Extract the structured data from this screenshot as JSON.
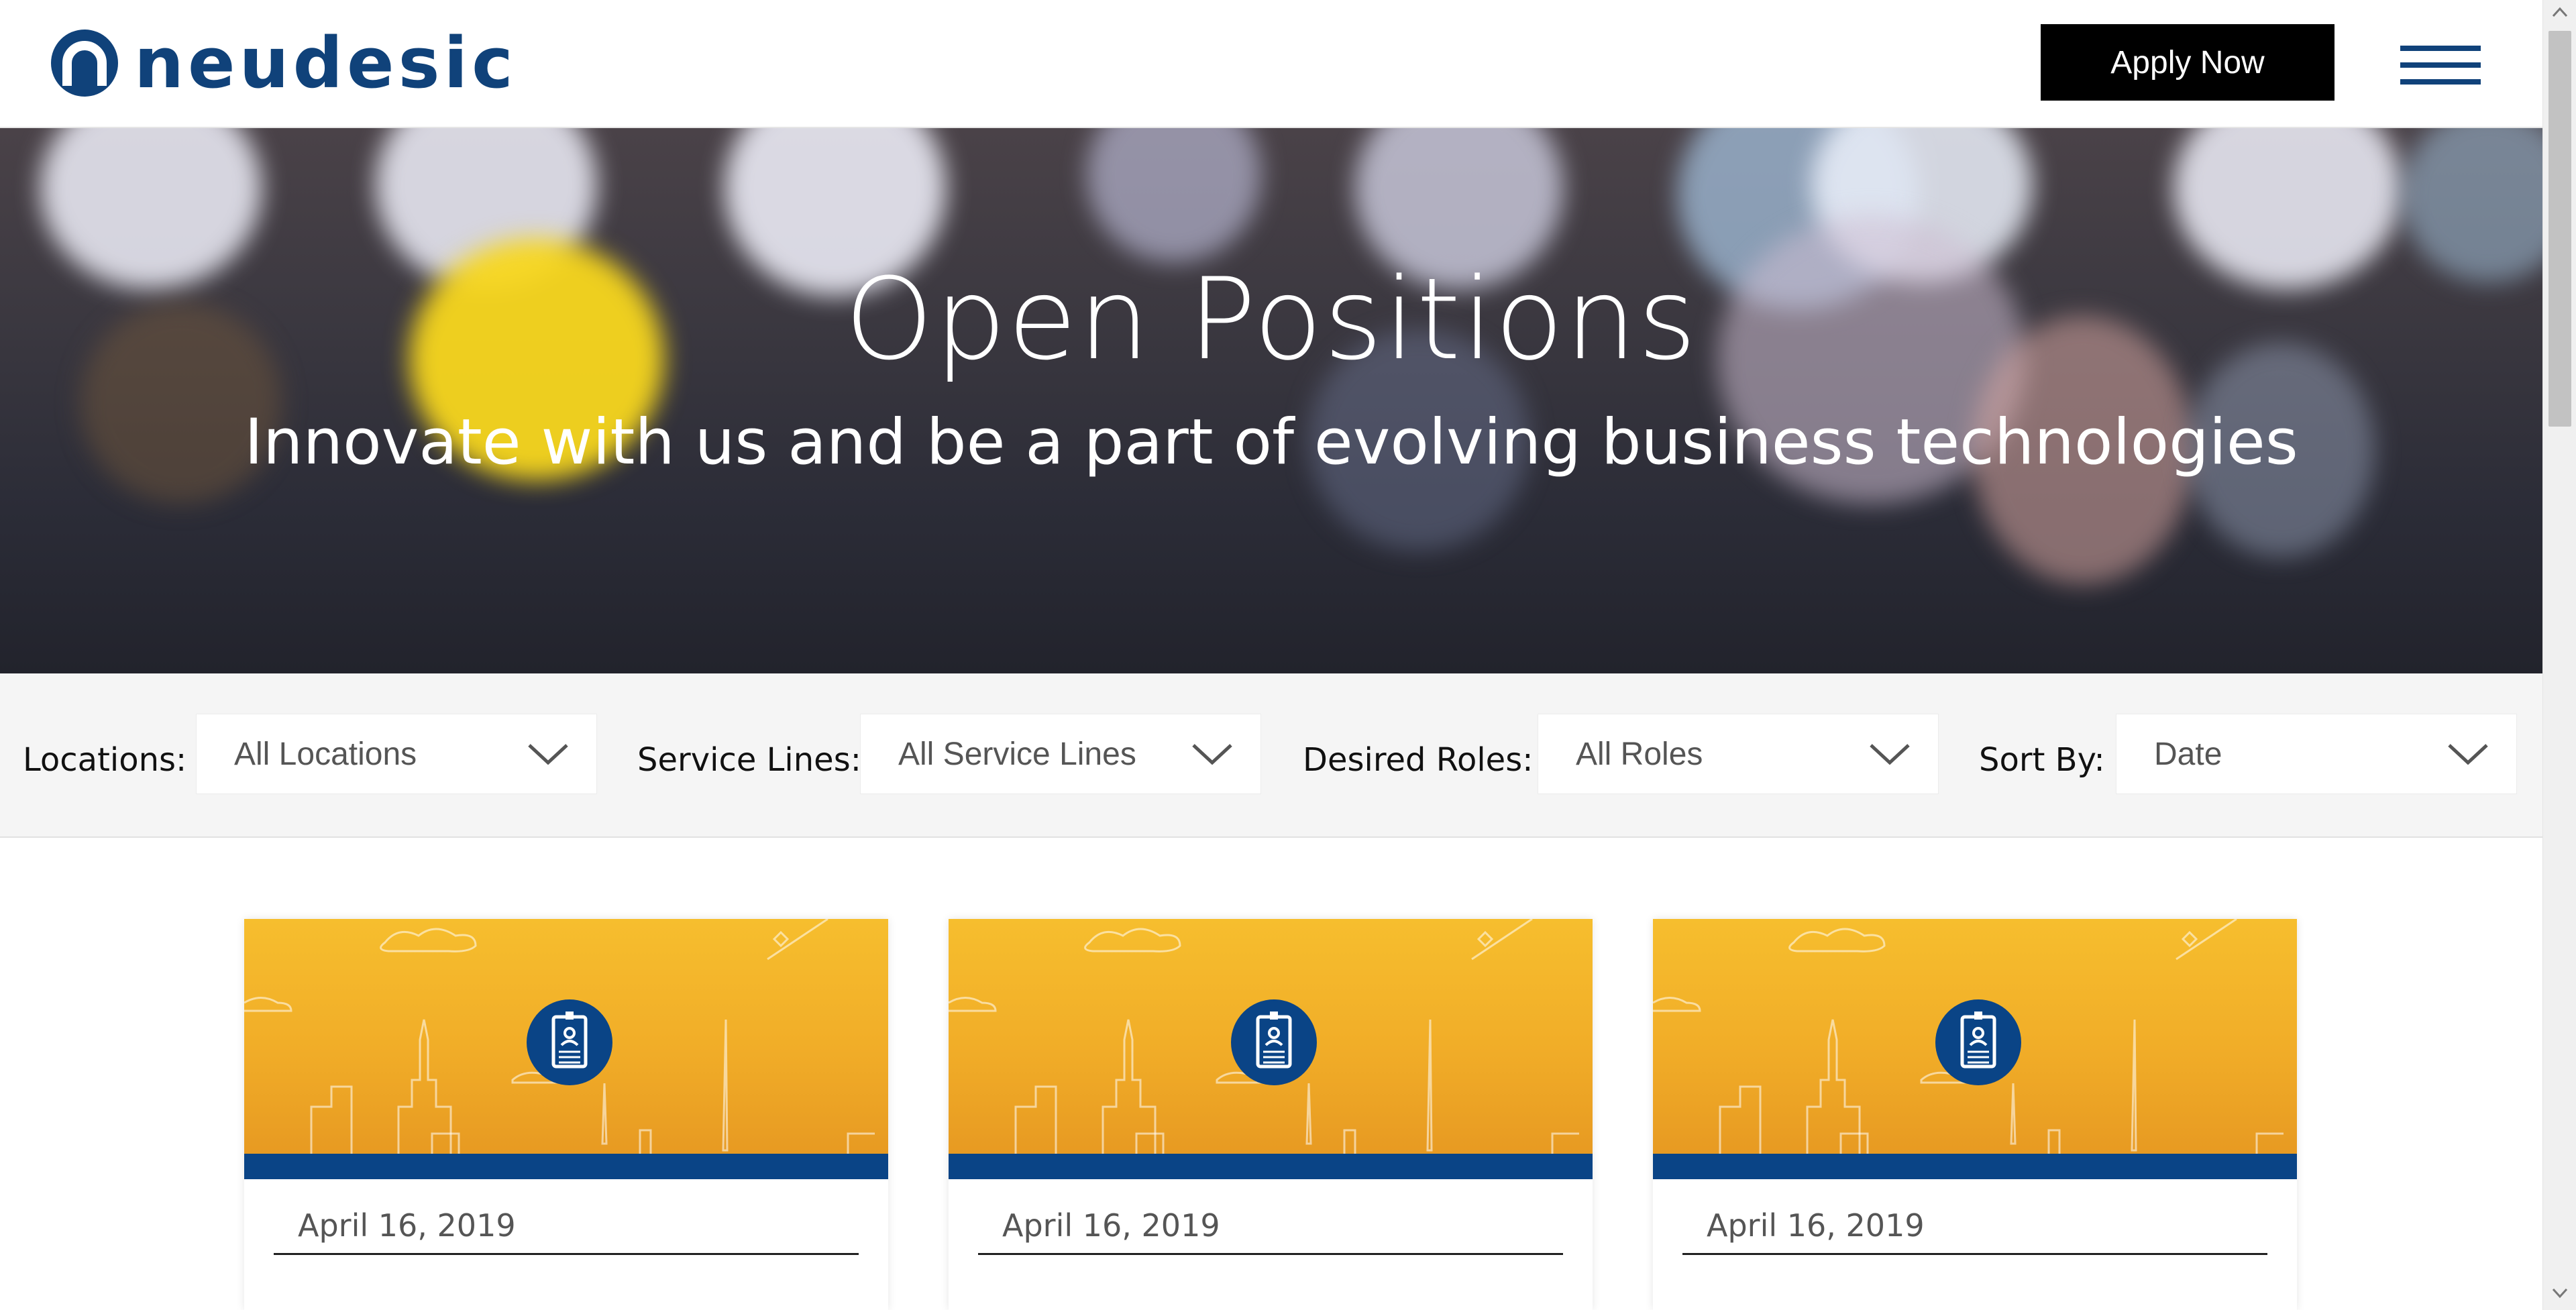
{
  "header": {
    "logo_text": "neudesic",
    "apply_label": "Apply Now",
    "menu_icon": "hamburger-menu-icon"
  },
  "hero": {
    "title": "Open Positions",
    "subtitle": "Innovate with us and be a part of evolving business technologies"
  },
  "filters": {
    "locations": {
      "label": "Locations:",
      "value": "All Locations"
    },
    "service_lines": {
      "label": "Service Lines:",
      "value": "All Service Lines"
    },
    "roles": {
      "label": "Desired Roles:",
      "value": "All Roles"
    },
    "sort": {
      "label": "Sort By:",
      "value": "Date"
    }
  },
  "cards": [
    {
      "date": "April 16, 2019",
      "icon": "id-badge-icon"
    },
    {
      "date": "April 16, 2019",
      "icon": "id-badge-icon"
    },
    {
      "date": "April 16, 2019",
      "icon": "id-badge-icon"
    }
  ],
  "colors": {
    "brand_blue": "#10427a",
    "card_orange": "#f1ad28",
    "card_bar_blue": "#0a4486",
    "button_black": "#000000"
  }
}
